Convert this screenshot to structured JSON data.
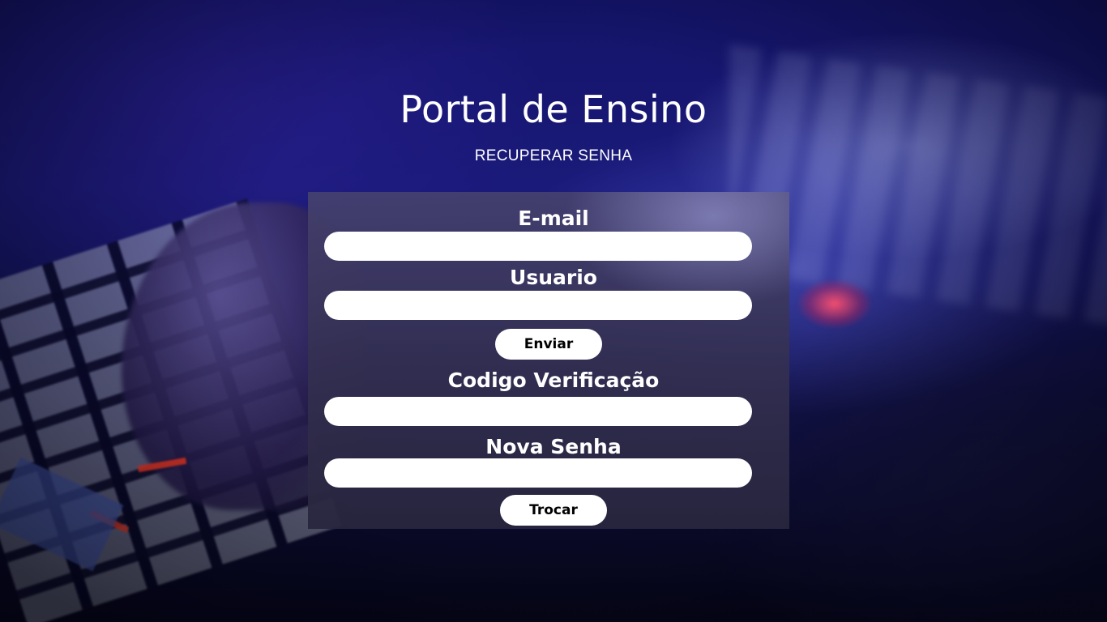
{
  "header": {
    "title": "Portal de Ensino",
    "subtitle": "RECUPERAR SENHA"
  },
  "form": {
    "email": {
      "label": "E-mail",
      "value": ""
    },
    "usuario": {
      "label": "Usuario",
      "value": ""
    },
    "send_button": "Enviar",
    "codigo": {
      "label": "Codigo Verificação",
      "value": ""
    },
    "nova_senha": {
      "label": "Nova Senha",
      "value": ""
    },
    "change_button": "Trocar"
  }
}
